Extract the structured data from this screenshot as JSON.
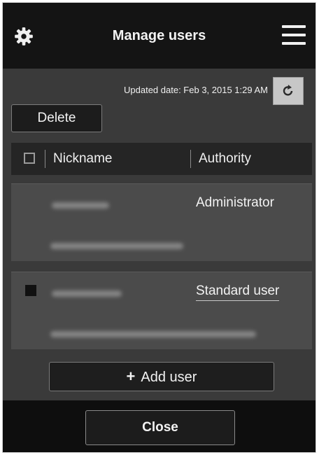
{
  "header": {
    "title": "Manage users",
    "settings_icon": "gear-icon",
    "menu_icon": "hamburger-menu-icon"
  },
  "status": {
    "updated": "Updated date: Feb 3, 2015 1:29 AM",
    "refresh_icon": "refresh-icon"
  },
  "toolbar": {
    "delete_label": "Delete"
  },
  "table": {
    "columns": [
      "Nickname",
      "Authority"
    ],
    "users": [
      {
        "authority": "Administrator",
        "has_checkbox": false
      },
      {
        "authority": "Standard user",
        "has_checkbox": true
      }
    ]
  },
  "actions": {
    "add_user_label": "Add user",
    "add_icon": "plus-icon"
  },
  "footer": {
    "close_label": "Close"
  },
  "colors": {
    "titlebar_bg": "#141414",
    "content_bg": "#3a3a3a",
    "card_bg": "#4b4b4b",
    "footer_bg": "#0e0e0e",
    "text": "#f2f2f2"
  }
}
